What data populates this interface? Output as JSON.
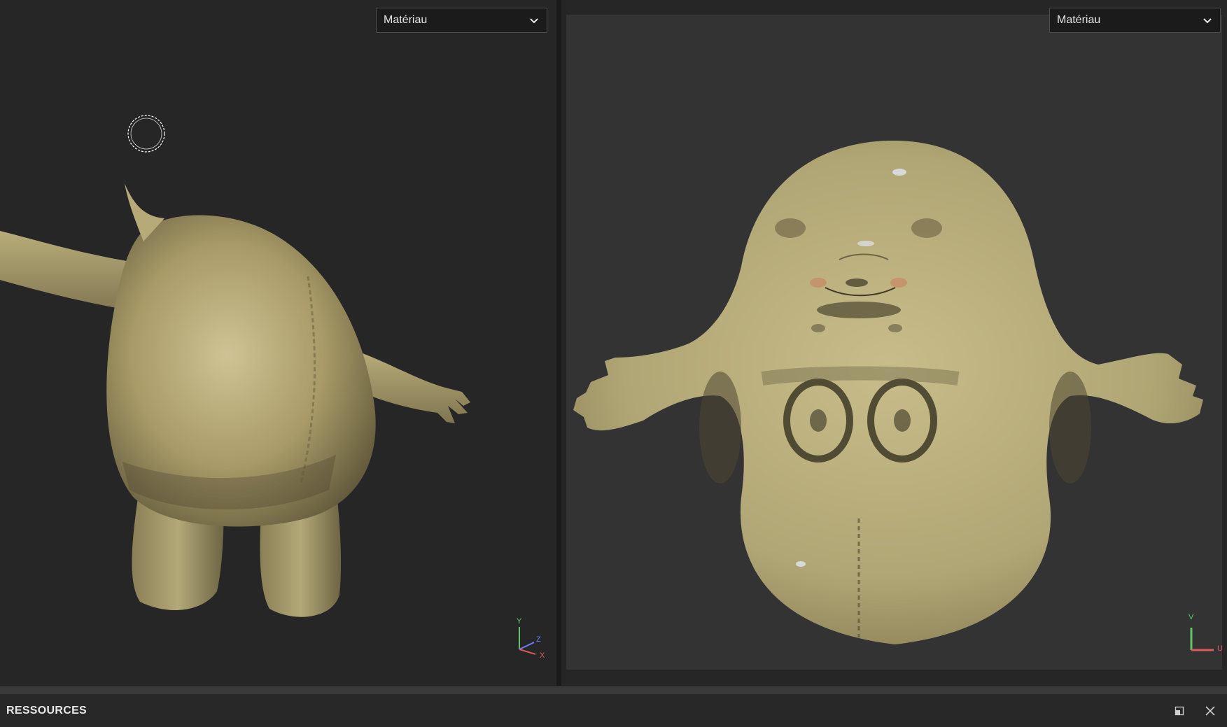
{
  "viewport3d": {
    "material_dropdown": {
      "selected": "Matériau",
      "icon": "chevron-down-icon"
    },
    "axis_gizmo": {
      "labels": [
        "Y",
        "Z",
        "X"
      ]
    }
  },
  "viewport2d": {
    "material_dropdown": {
      "selected": "Matériau",
      "icon": "chevron-down-icon"
    },
    "uv_gizmo": {
      "labels": [
        "V",
        "U"
      ]
    }
  },
  "bottom_panel": {
    "title": "RESSOURCES",
    "actions": [
      {
        "name": "undock-icon"
      },
      {
        "name": "close-icon"
      }
    ]
  },
  "colors": {
    "background": "#262626",
    "uv_canvas": "#333333",
    "texture_base": "#b5aa78",
    "axis_x": "#e05a5a",
    "axis_y": "#5fc46a",
    "axis_z": "#6b7bff"
  }
}
